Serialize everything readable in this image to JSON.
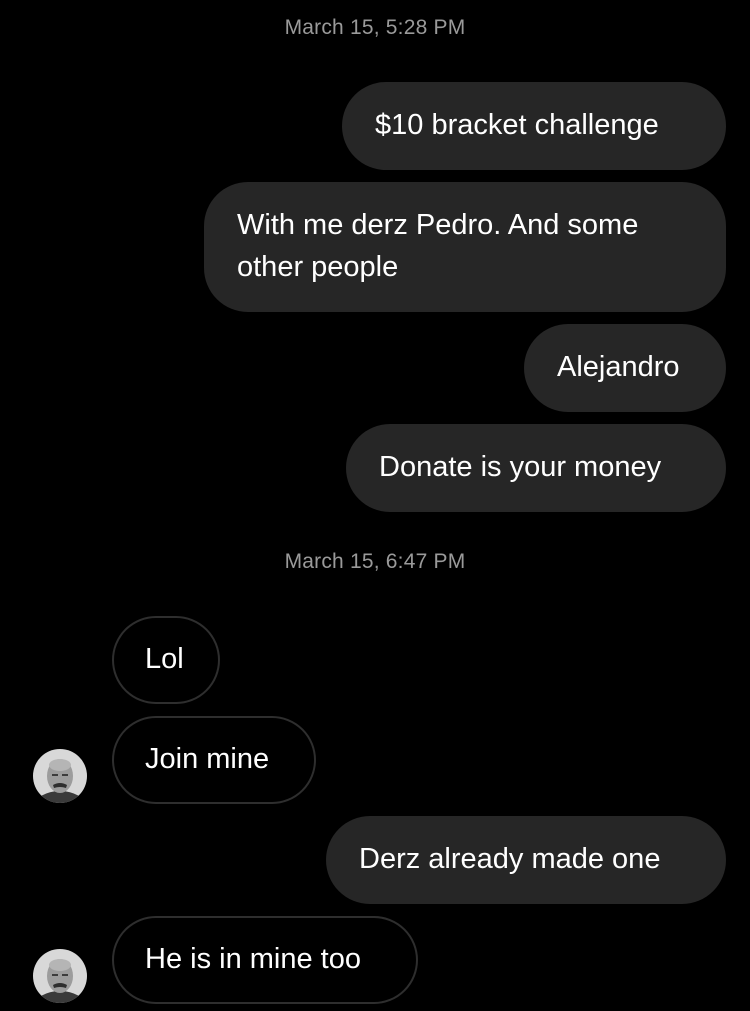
{
  "thread": {
    "timestamp_1": "March 15, 5:28 PM",
    "timestamp_2": "March 15, 6:47 PM"
  },
  "messages": [
    {
      "from": "me",
      "text": "$10 bracket challenge"
    },
    {
      "from": "me",
      "text": "With me derz Pedro. And some other people"
    },
    {
      "from": "me",
      "text": "Alejandro"
    },
    {
      "from": "me",
      "text": "Donate is your money"
    },
    {
      "from": "them",
      "text": "Lol"
    },
    {
      "from": "them",
      "text": "Join mine"
    },
    {
      "from": "me",
      "text": "Derz already made one"
    },
    {
      "from": "them",
      "text": "He is in mine too"
    }
  ],
  "colors": {
    "background": "#000000",
    "outgoing_bubble": "#262626",
    "incoming_border": "#2e2e2e",
    "timestamp": "#9a9a9a"
  },
  "icons": {
    "contact_avatar": "contact-avatar-photo"
  }
}
